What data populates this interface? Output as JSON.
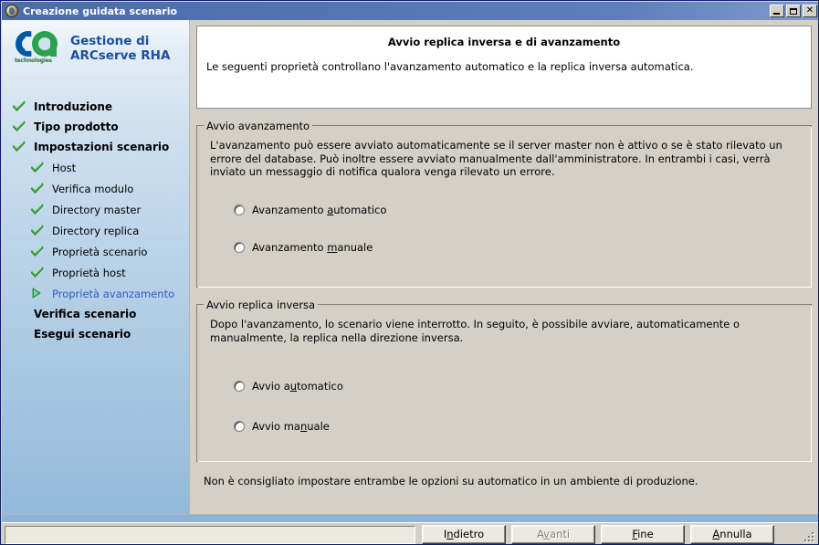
{
  "window": {
    "title": "Creazione guidata scenario",
    "icon": "app-globe-icon",
    "minimize_label": "",
    "maximize_label": "",
    "close_label": "✕"
  },
  "sidebar": {
    "brand": {
      "logo_text": "technologies",
      "line1": "Gestione di",
      "line2": "ARCserve RHA"
    },
    "steps": [
      {
        "label": "Introduzione",
        "level": "top",
        "state": "done",
        "icon": "check-icon"
      },
      {
        "label": "Tipo prodotto",
        "level": "top",
        "state": "done",
        "icon": "check-icon"
      },
      {
        "label": "Impostazioni scenario",
        "level": "top",
        "state": "done",
        "icon": "check-icon"
      },
      {
        "label": "Host",
        "level": "sub",
        "state": "done",
        "icon": "check-icon"
      },
      {
        "label": "Verifica modulo",
        "level": "sub",
        "state": "done",
        "icon": "check-icon"
      },
      {
        "label": "Directory master",
        "level": "sub",
        "state": "done",
        "icon": "check-icon"
      },
      {
        "label": "Directory replica",
        "level": "sub",
        "state": "done",
        "icon": "check-icon"
      },
      {
        "label": "Proprietà scenario",
        "level": "sub",
        "state": "done",
        "icon": "check-icon"
      },
      {
        "label": "Proprietà host",
        "level": "sub",
        "state": "done",
        "icon": "check-icon"
      },
      {
        "label": "Proprietà avanzamento",
        "level": "sub",
        "state": "current",
        "icon": "arrow-right-icon"
      },
      {
        "label": "Verifica scenario",
        "level": "top",
        "state": "pending",
        "icon": "none"
      },
      {
        "label": "Esegui scenario",
        "level": "top",
        "state": "pending",
        "icon": "none"
      }
    ]
  },
  "main": {
    "header": {
      "title": "Avvio replica inversa e di avanzamento",
      "subtitle": "Le seguenti proprietà controllano l'avanzamento automatico e la replica inversa automatica."
    },
    "group_forward": {
      "legend": "Avvio avanzamento",
      "description": "L'avanzamento può essere avviato automaticamente se il server master non è attivo o se è stato rilevato un errore del database. Può inoltre essere avviato manualmente dall'amministratore. In entrambi i casi, verrà inviato un messaggio di notifica qualora venga rilevato un errore.",
      "options": [
        {
          "label_pre": "Avanzamento ",
          "label_accel": "a",
          "label_post": "utomatico",
          "checked": false
        },
        {
          "label_pre": "Avanzamento ",
          "label_accel": "m",
          "label_post": "anuale",
          "checked": false
        }
      ]
    },
    "group_backward": {
      "legend": "Avvio replica inversa",
      "description": "Dopo l'avanzamento, lo scenario viene interrotto. In seguito, è possibile avviare, automaticamente o manualmente, la replica nella direzione inversa.",
      "options": [
        {
          "label_pre": "Avvio a",
          "label_accel": "u",
          "label_post": "tomatico",
          "checked": false
        },
        {
          "label_pre": "Avvio ma",
          "label_accel": "n",
          "label_post": "uale",
          "checked": false
        }
      ]
    },
    "note": "Non è consigliato impostare entrambe le opzioni su automatico in un ambiente di produzione."
  },
  "footer": {
    "buttons": [
      {
        "pre": "I",
        "accel": "n",
        "post": "dietro",
        "disabled": false,
        "name": "back-button"
      },
      {
        "pre": "A",
        "accel": "v",
        "post": "anti",
        "disabled": true,
        "name": "next-button"
      },
      {
        "pre": "",
        "accel": "F",
        "post": "ine",
        "disabled": false,
        "name": "finish-button"
      },
      {
        "pre": "",
        "accel": "A",
        "post": "nnulla",
        "disabled": false,
        "name": "cancel-button"
      }
    ],
    "status_text": ""
  },
  "colors": {
    "titlebar_start": "#4a6bac",
    "titlebar_end": "#7e9bcd",
    "sidebar_top": "#f3f7fb",
    "sidebar_bottom": "#93bada",
    "dialog_face": "#d4d0c8",
    "brand_blue": "#1b4f9c",
    "current_step_blue": "#2a5fc8",
    "check_green": "#3aa53a",
    "logo_blue": "#0057a8",
    "logo_green": "#2ba24c",
    "footer_blue": "#8fb3d6"
  }
}
